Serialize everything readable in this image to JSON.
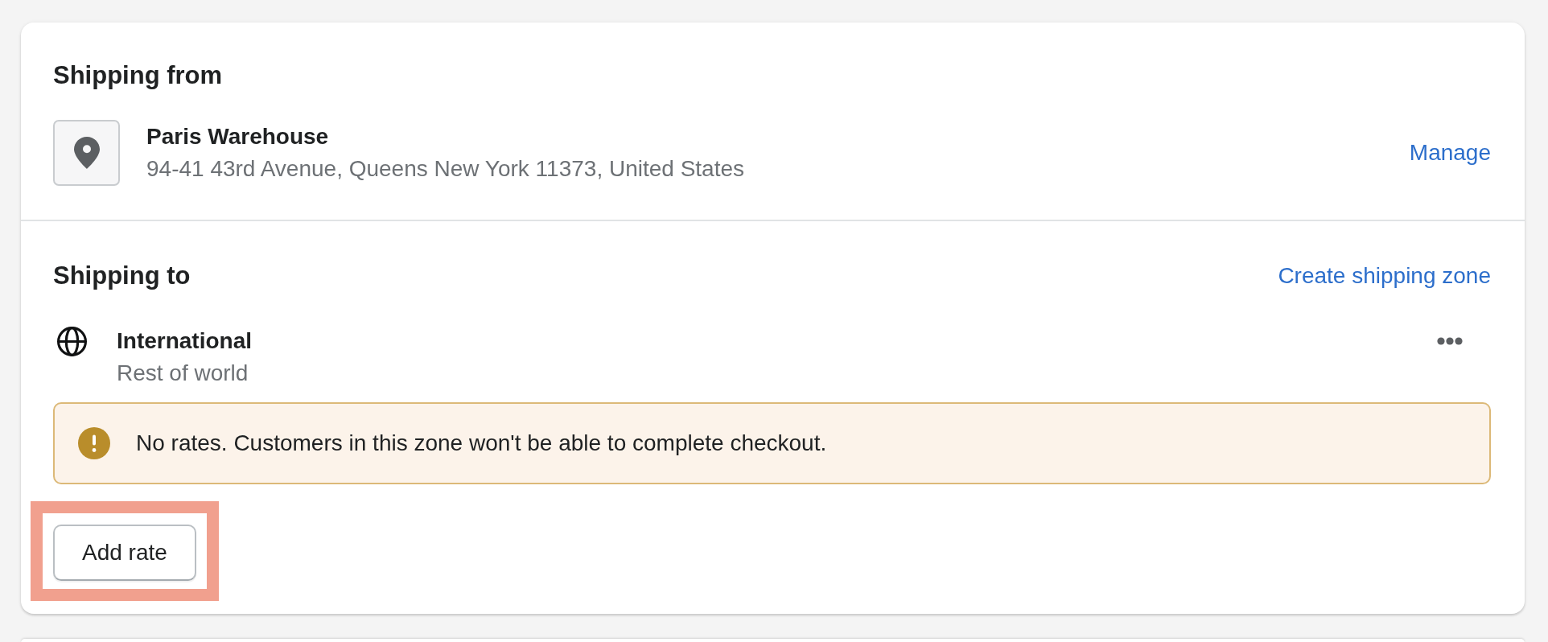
{
  "shipping_from": {
    "heading": "Shipping from",
    "location": {
      "name": "Paris Warehouse",
      "address": "94-41 43rd Avenue, Queens New York 11373, United States"
    },
    "manage_link": "Manage"
  },
  "shipping_to": {
    "heading": "Shipping to",
    "create_link": "Create shipping zone",
    "zones": [
      {
        "name": "International",
        "description": "Rest of world",
        "banner": {
          "kind": "warning",
          "text": "No rates. Customers in this zone won't be able to complete checkout."
        },
        "add_rate_button": {
          "label": "Add rate",
          "highlighted": true
        }
      }
    ]
  }
}
